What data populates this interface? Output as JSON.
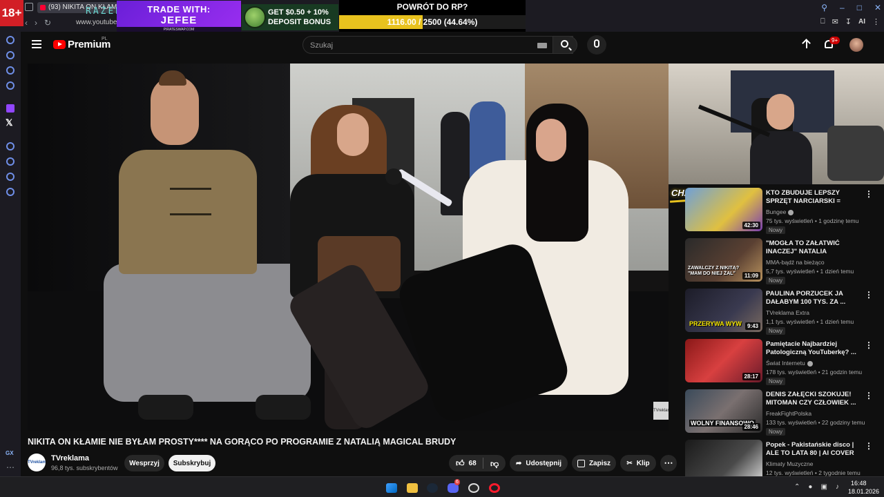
{
  "browser": {
    "age_badge": "18+",
    "tab_title": "(93) NIKITA ON KŁAM",
    "razer_logo": "RAZER",
    "url": "www.youtube"
  },
  "ads": {
    "trade_line1": "TRADE WITH:",
    "trade_line2": "JEFEE",
    "trade_footer": "PIRATESWAP.COM",
    "bonus_line1": "GET $0.50 + 10%",
    "bonus_line2": "DEPOSIT BONUS"
  },
  "progress": {
    "title": "POWRÓT DO RP?",
    "text": "1116.00 / 2500 (44.64%)",
    "fraction": 0.4464
  },
  "browser_toolbar": {
    "ai_label": "AI"
  },
  "header": {
    "brand": "Premium",
    "country": "PL",
    "search_placeholder": "Szukaj",
    "notifications_badge": "9+"
  },
  "video": {
    "title": "NIKITA ON KŁAMIE NIE BYŁAM PROSTY**** NA GORĄCO PO PROGRAMIE Z NATALIĄ MAGICAL BRUDY",
    "watermark": "TVreklama",
    "overlay_label": "CHAT"
  },
  "channel": {
    "avatar_text": "TVreklama",
    "name": "TVreklama",
    "subscribers": "96,8 tys. subskrybentów",
    "support_label": "Wesprzyj",
    "subscribe_label": "Subskrybuj"
  },
  "actions": {
    "likes": "68",
    "share": "Udostępnij",
    "save": "Zapisz",
    "clip": "Klip"
  },
  "suggestions": [
    {
      "title": "KTO ZBUDUJE LEPSZY SPRZĘT NARCIARSKI = WYGRYWA",
      "channel": "Bungee",
      "meta": "75 tys. wyświetleń • 1 godzinę temu",
      "badge": "Nowy",
      "duration": "42:30",
      "verified": true
    },
    {
      "title": "\"MOGŁA TO ZAŁATWIĆ INACZEJ\" NATALIA MAGICAL...",
      "channel": "MMA-bądź na bieżąco",
      "meta": "5,7 tys. wyświetleń • 1 dzień temu",
      "badge": "Nowy",
      "duration": "11:09",
      "thumb_text": "ZAWALCZY Z NIKITĄ? \"MAM DO NIEJ ŻAL\"",
      "verified": false
    },
    {
      "title": "PAULINA PORZUCEK JA DAŁABYM 100 TYS. ZA ...",
      "channel": "TVreklama Extra",
      "meta": "1,1 tys. wyświetleń • 1 dzień temu",
      "badge": "Nowy",
      "duration": "9:43",
      "thumb_text": "PRZERYWA WYW",
      "verified": false
    },
    {
      "title": "Pamiętacie Najbardziej Patologiczną YouTuberkę? ...",
      "channel": "Świat Internetu",
      "meta": "178 tys. wyświetleń • 21 godzin temu",
      "badge": "Nowy",
      "duration": "28:17",
      "verified": true
    },
    {
      "title": "DENIS ZAŁĘCKI SZOKUJE! MITOMAN CZY CZŁOWIEK ...",
      "channel": "FreakFightPolska",
      "meta": "133 tys. wyświetleń • 22 godziny temu",
      "badge": "Nowy",
      "duration": "28:46",
      "thumb_text": "WOLNY FINANSOWO",
      "verified": false
    },
    {
      "title": "Popek - Pakistańskie disco | ALE TO LATA 80 | AI COVER",
      "channel": "Klimaty Muzyczne",
      "meta": "12 tys. wyświetleń • 2 tygodnie temu",
      "badge": "",
      "duration": "",
      "verified": false
    }
  ],
  "taskbar": {
    "time": "16:48",
    "date": "18.01.2026",
    "chat_badge": "6"
  }
}
